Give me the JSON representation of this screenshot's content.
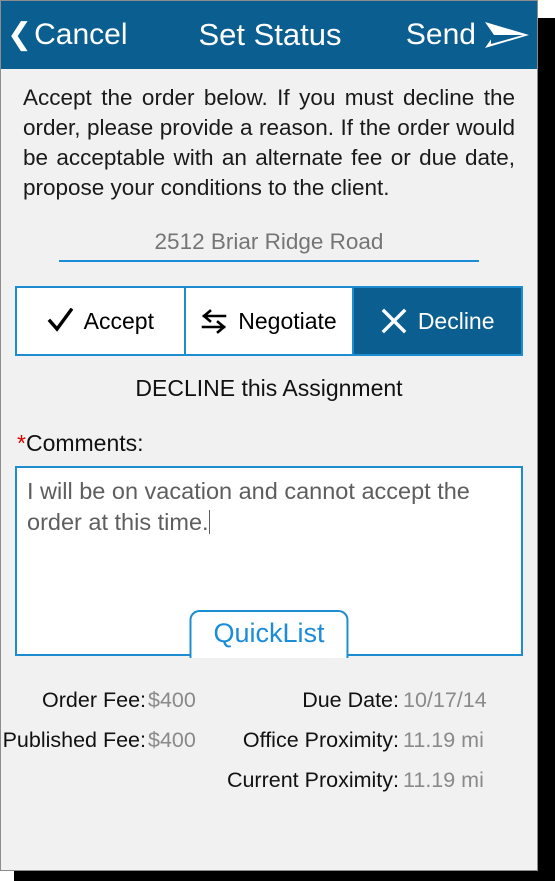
{
  "header": {
    "cancel_label": "Cancel",
    "title": "Set Status",
    "send_label": "Send",
    "back_icon": "chevron-left-icon",
    "send_icon": "send-arrow-icon",
    "background_color": "#0b5e90",
    "text_color": "#ffffff"
  },
  "instructions": "Accept the order below. If you must decline the order, please provide a reason. If the order would be acceptable with an alternate fee or due date, propose your conditions to the client.",
  "address": {
    "value": "2512 Briar Ridge Road",
    "underline_color": "#1a8cd8"
  },
  "status_options": [
    {
      "label": "Accept",
      "icon": "check-icon",
      "selected": false
    },
    {
      "label": "Negotiate",
      "icon": "swap-arrows-icon",
      "selected": false
    },
    {
      "label": "Decline",
      "icon": "close-x-icon",
      "selected": true
    }
  ],
  "decline_heading": "DECLINE this Assignment",
  "comments": {
    "required_marker": "*",
    "label": "Comments:",
    "value": "I will be on vacation and cannot accept the order at this time.",
    "quicklist_label": "QuickList",
    "required_color": "#e00000",
    "accent_color": "#1a8cd8"
  },
  "details": [
    [
      {
        "label": "Order Fee:",
        "value": "$400"
      },
      {
        "label": "Due Date:",
        "value": "10/17/14"
      }
    ],
    [
      {
        "label": "Published Fee:",
        "value": "$400"
      },
      {
        "label": "Office Proximity:",
        "value": "11.19 mi"
      }
    ],
    [
      {
        "label": "",
        "value": ""
      },
      {
        "label": "Current Proximity:",
        "value": "11.19 mi"
      }
    ]
  ]
}
